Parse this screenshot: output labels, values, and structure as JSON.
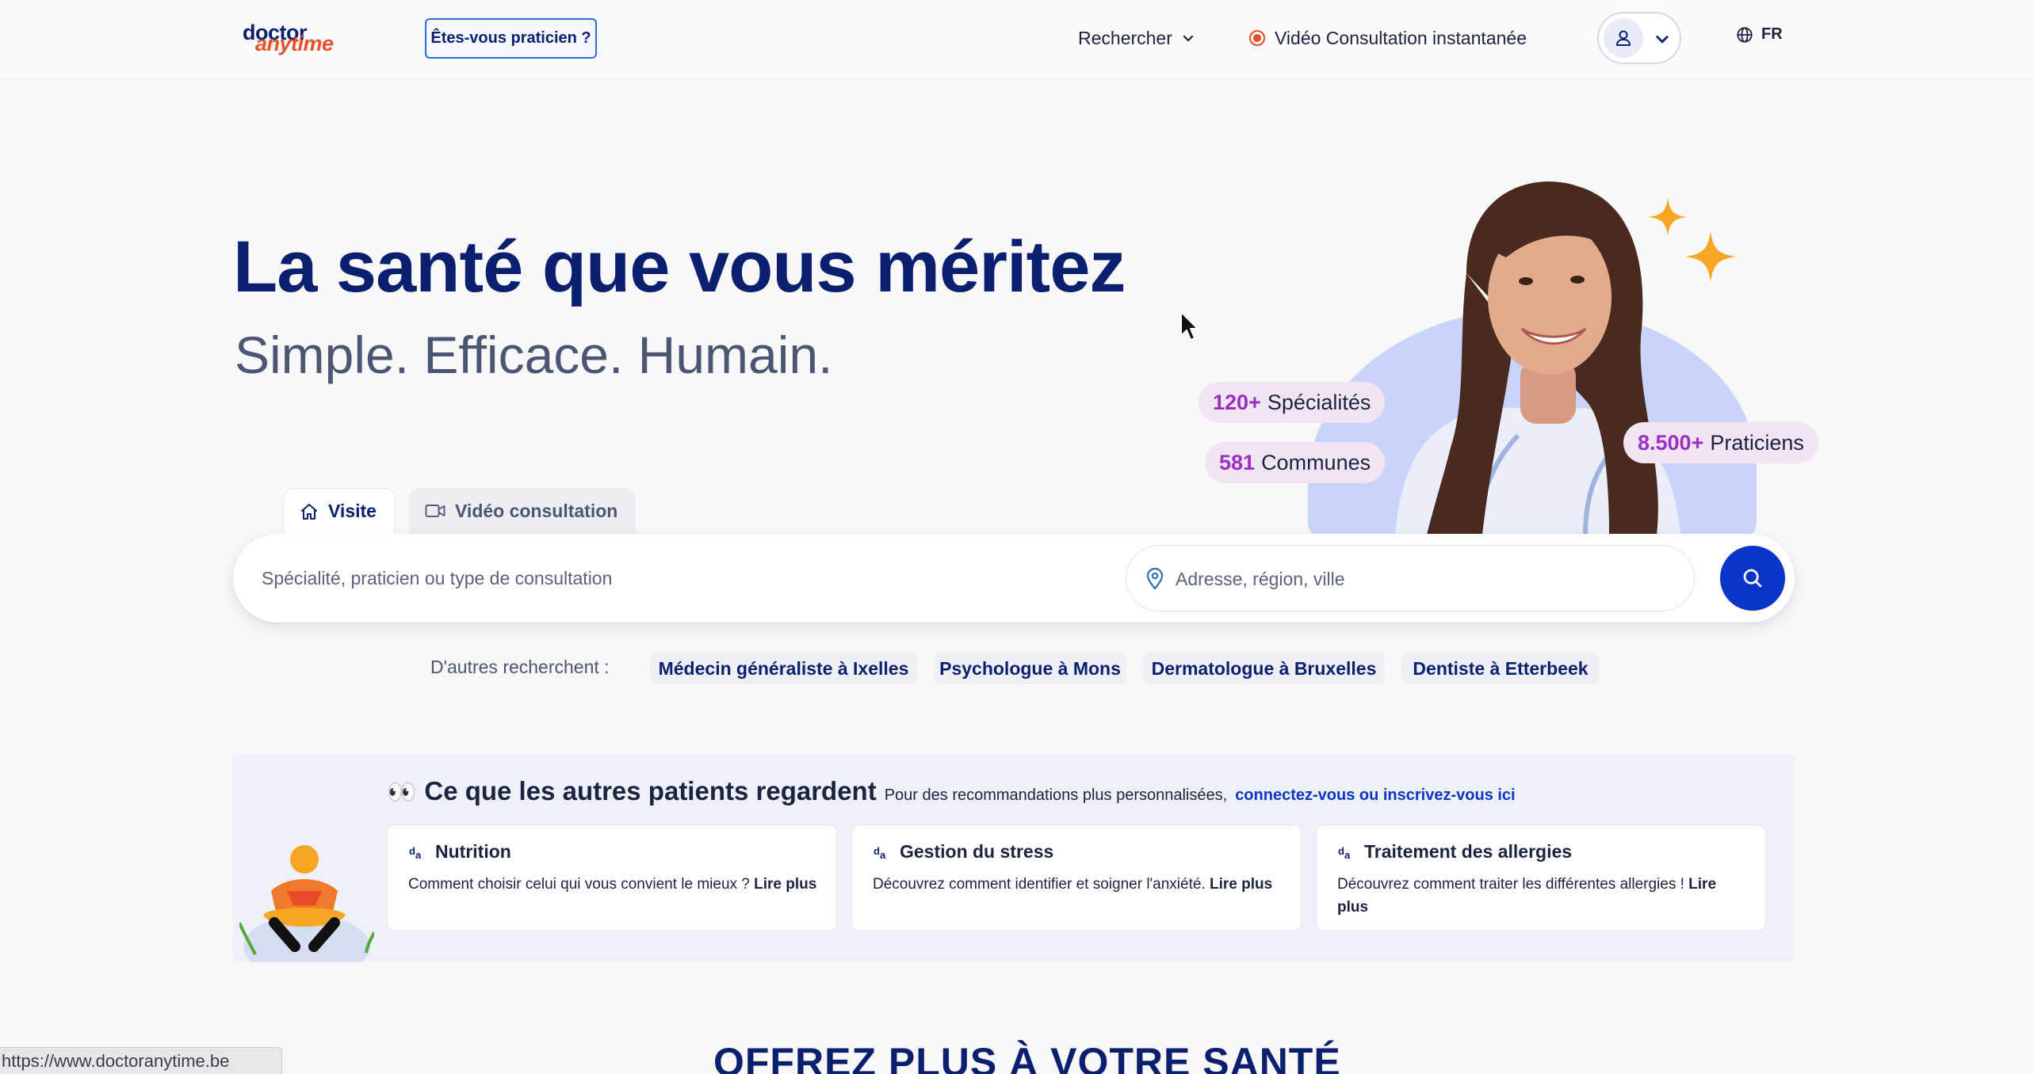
{
  "header": {
    "logo_top": "doctor",
    "logo_bottom": "anytime",
    "pro_button": "Êtes-vous praticien ?",
    "nav_search": "Rechercher",
    "nav_video": "Vidéo Consultation instantanée",
    "lang": "FR"
  },
  "hero": {
    "title": "La santé que vous méritez",
    "subtitle": "Simple. Efficace. Humain.",
    "stats": [
      {
        "num": "120+",
        "label": "Spécialités"
      },
      {
        "num": "581",
        "label": "Communes"
      },
      {
        "num": "8.500+",
        "label": "Praticiens"
      }
    ]
  },
  "search": {
    "tabs": [
      "Visite",
      "Vidéo consultation"
    ],
    "spec_placeholder": "Spécialité, praticien ou type de consultation",
    "addr_placeholder": "Adresse, région, ville"
  },
  "others": {
    "label": "D'autres recherchent :",
    "chips": [
      "Médecin généraliste à Ixelles",
      "Psychologue à Mons",
      "Dermatologue à Bruxelles",
      "Dentiste à Etterbeek"
    ]
  },
  "reco": {
    "eyes": "👀",
    "title": "Ce que les autres patients regardent",
    "note": "Pour des recommandations plus personnalisées,",
    "link": "connectez-vous ou inscrivez-vous ici",
    "cards": [
      {
        "title": "Nutrition",
        "body": "Comment choisir celui qui vous convient le mieux ? ",
        "more": "Lire plus"
      },
      {
        "title": "Gestion du stress",
        "body": "Découvrez comment identifier et soigner l'anxiété. ",
        "more": "Lire plus"
      },
      {
        "title": "Traitement des allergies",
        "body": "Découvrez comment traiter les différentes allergies ! ",
        "more": "Lire plus"
      }
    ]
  },
  "section_title": "OFFREZ PLUS À VOTRE SANTÉ",
  "status_url": "https://www.doctoranytime.be",
  "colors": {
    "brand_navy": "#0a1f6e",
    "brand_orange": "#e8522a",
    "accent_blue": "#0a35c8",
    "stat_purple": "#9b2fc4",
    "stat_bg": "#f1e5f4",
    "sparkle": "#f6a623"
  },
  "icons": [
    "chevron-down-icon",
    "record-dot-icon",
    "user-icon",
    "globe-icon",
    "home-icon",
    "video-camera-icon",
    "location-pin-icon",
    "search-icon",
    "sparkle-icon",
    "doctoranytime-mark-icon",
    "cursor-icon"
  ]
}
